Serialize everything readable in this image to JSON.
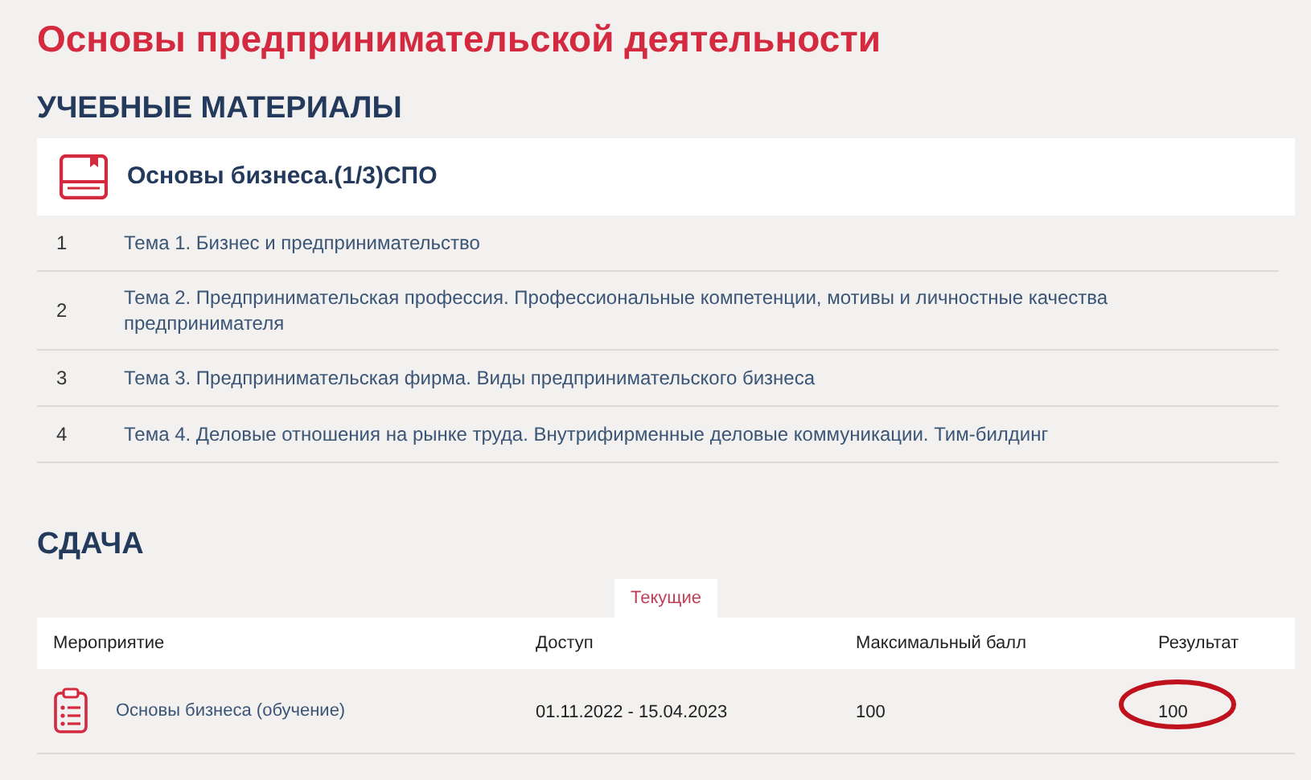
{
  "page_title": "Основы предпринимательской деятельности",
  "materials": {
    "heading": "УЧЕБНЫЕ МАТЕРИАЛЫ",
    "course": "Основы бизнеса.(1/3)СПО",
    "topics": [
      {
        "number": "1",
        "title": "Тема 1. Бизнес и предпринимательство"
      },
      {
        "number": "2",
        "title": "Тема 2. Предпринимательская профессия. Профессиональные компетенции, мотивы и личностные качества предпринимателя"
      },
      {
        "number": "3",
        "title": "Тема 3. Предпринимательская фирма. Виды предпринимательского бизнеса"
      },
      {
        "number": "4",
        "title": "Тема 4. Деловые отношения на рынке труда. Внутрифирменные деловые коммуникации. Тим-билдинг"
      }
    ]
  },
  "submission": {
    "heading": "СДАЧА",
    "tabs": [
      {
        "label": "Текущие",
        "selected": true
      }
    ],
    "table": {
      "columns": [
        "Мероприятие",
        "Доступ",
        "Максимальный балл",
        "Результат"
      ],
      "rows": [
        {
          "event": "Основы бизнеса (обучение)",
          "access": "01.11.2022 - 15.04.2023",
          "max_score": "100",
          "result": "100",
          "circled": true
        }
      ]
    }
  }
}
